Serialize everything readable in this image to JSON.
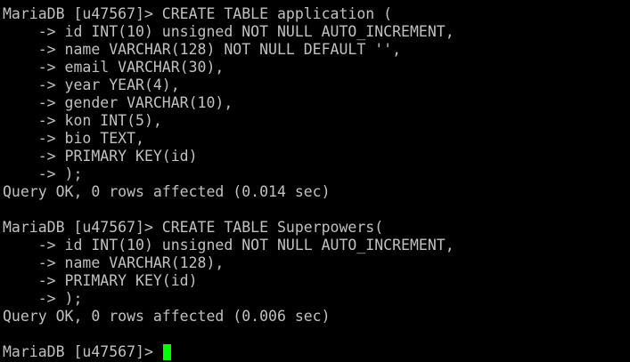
{
  "terminal": {
    "lines": [
      "MariaDB [u47567]> CREATE TABLE application (",
      "    -> id INT(10) unsigned NOT NULL AUTO_INCREMENT,",
      "    -> name VARCHAR(128) NOT NULL DEFAULT '',",
      "    -> email VARCHAR(30),",
      "    -> year YEAR(4),",
      "    -> gender VARCHAR(10),",
      "    -> kon INT(5),",
      "    -> bio TEXT,",
      "    -> PRIMARY KEY(id)",
      "    -> );",
      "Query OK, 0 rows affected (0.014 sec)",
      "",
      "MariaDB [u47567]> CREATE TABLE Superpowers(",
      "    -> id INT(10) unsigned NOT NULL AUTO_INCREMENT,",
      "    -> name VARCHAR(128),",
      "    -> PRIMARY KEY(id)",
      "    -> );",
      "Query OK, 0 rows affected (0.006 sec)",
      "",
      "MariaDB [u47567]> "
    ],
    "colors": {
      "background": "#000000",
      "text": "#c0c0c0",
      "cursor": "#00ff00"
    }
  }
}
